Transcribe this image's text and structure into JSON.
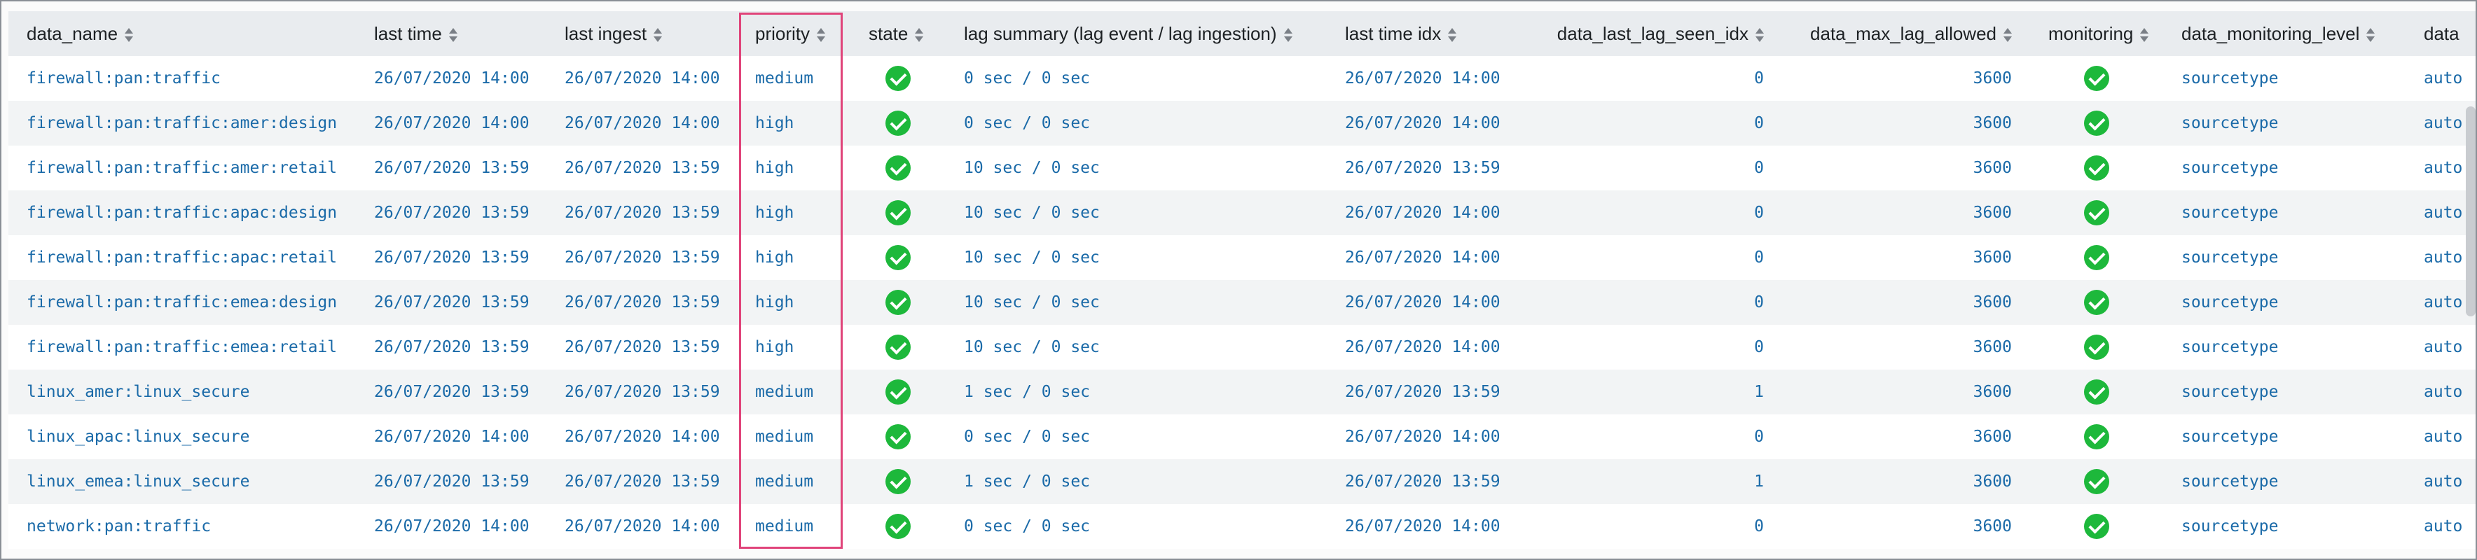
{
  "columns": [
    {
      "label": "data_name"
    },
    {
      "label": "last time"
    },
    {
      "label": "last ingest"
    },
    {
      "label": "priority"
    },
    {
      "label": "state"
    },
    {
      "label": "lag summary (lag event / lag ingestion)"
    },
    {
      "label": "last time idx"
    },
    {
      "label": "data_last_lag_seen_idx"
    },
    {
      "label": "data_max_lag_allowed"
    },
    {
      "label": "monitoring"
    },
    {
      "label": "data_monitoring_level"
    },
    {
      "label": "data"
    }
  ],
  "state_icon": "check-circle-icon",
  "monitoring_icon": "check-circle-icon",
  "status_color": "#1db83b",
  "highlight_color": "#e0447a",
  "rows": [
    {
      "data_name": "firewall:pan:traffic",
      "last_time": "26/07/2020 14:00",
      "last_ingest": "26/07/2020 14:00",
      "priority": "medium",
      "lag_summary": "0 sec / 0 sec",
      "last_time_idx": "26/07/2020 14:00",
      "last_lag_seen_idx": "0",
      "max_lag_allowed": "3600",
      "monitoring_level": "sourcetype",
      "data_extra": "auto"
    },
    {
      "data_name": "firewall:pan:traffic:amer:design",
      "last_time": "26/07/2020 14:00",
      "last_ingest": "26/07/2020 14:00",
      "priority": "high",
      "lag_summary": "0 sec / 0 sec",
      "last_time_idx": "26/07/2020 14:00",
      "last_lag_seen_idx": "0",
      "max_lag_allowed": "3600",
      "monitoring_level": "sourcetype",
      "data_extra": "auto"
    },
    {
      "data_name": "firewall:pan:traffic:amer:retail",
      "last_time": "26/07/2020 13:59",
      "last_ingest": "26/07/2020 13:59",
      "priority": "high",
      "lag_summary": "10 sec / 0 sec",
      "last_time_idx": "26/07/2020 13:59",
      "last_lag_seen_idx": "0",
      "max_lag_allowed": "3600",
      "monitoring_level": "sourcetype",
      "data_extra": "auto"
    },
    {
      "data_name": "firewall:pan:traffic:apac:design",
      "last_time": "26/07/2020 13:59",
      "last_ingest": "26/07/2020 13:59",
      "priority": "high",
      "lag_summary": "10 sec / 0 sec",
      "last_time_idx": "26/07/2020 14:00",
      "last_lag_seen_idx": "0",
      "max_lag_allowed": "3600",
      "monitoring_level": "sourcetype",
      "data_extra": "auto"
    },
    {
      "data_name": "firewall:pan:traffic:apac:retail",
      "last_time": "26/07/2020 13:59",
      "last_ingest": "26/07/2020 13:59",
      "priority": "high",
      "lag_summary": "10 sec / 0 sec",
      "last_time_idx": "26/07/2020 14:00",
      "last_lag_seen_idx": "0",
      "max_lag_allowed": "3600",
      "monitoring_level": "sourcetype",
      "data_extra": "auto"
    },
    {
      "data_name": "firewall:pan:traffic:emea:design",
      "last_time": "26/07/2020 13:59",
      "last_ingest": "26/07/2020 13:59",
      "priority": "high",
      "lag_summary": "10 sec / 0 sec",
      "last_time_idx": "26/07/2020 14:00",
      "last_lag_seen_idx": "0",
      "max_lag_allowed": "3600",
      "monitoring_level": "sourcetype",
      "data_extra": "auto"
    },
    {
      "data_name": "firewall:pan:traffic:emea:retail",
      "last_time": "26/07/2020 13:59",
      "last_ingest": "26/07/2020 13:59",
      "priority": "high",
      "lag_summary": "10 sec / 0 sec",
      "last_time_idx": "26/07/2020 14:00",
      "last_lag_seen_idx": "0",
      "max_lag_allowed": "3600",
      "monitoring_level": "sourcetype",
      "data_extra": "auto"
    },
    {
      "data_name": "linux_amer:linux_secure",
      "last_time": "26/07/2020 13:59",
      "last_ingest": "26/07/2020 13:59",
      "priority": "medium",
      "lag_summary": "1 sec / 0 sec",
      "last_time_idx": "26/07/2020 13:59",
      "last_lag_seen_idx": "1",
      "max_lag_allowed": "3600",
      "monitoring_level": "sourcetype",
      "data_extra": "auto"
    },
    {
      "data_name": "linux_apac:linux_secure",
      "last_time": "26/07/2020 14:00",
      "last_ingest": "26/07/2020 14:00",
      "priority": "medium",
      "lag_summary": "0 sec / 0 sec",
      "last_time_idx": "26/07/2020 14:00",
      "last_lag_seen_idx": "0",
      "max_lag_allowed": "3600",
      "monitoring_level": "sourcetype",
      "data_extra": "auto"
    },
    {
      "data_name": "linux_emea:linux_secure",
      "last_time": "26/07/2020 13:59",
      "last_ingest": "26/07/2020 13:59",
      "priority": "medium",
      "lag_summary": "1 sec / 0 sec",
      "last_time_idx": "26/07/2020 13:59",
      "last_lag_seen_idx": "1",
      "max_lag_allowed": "3600",
      "monitoring_level": "sourcetype",
      "data_extra": "auto"
    },
    {
      "data_name": "network:pan:traffic",
      "last_time": "26/07/2020 14:00",
      "last_ingest": "26/07/2020 14:00",
      "priority": "medium",
      "lag_summary": "0 sec / 0 sec",
      "last_time_idx": "26/07/2020 14:00",
      "last_lag_seen_idx": "0",
      "max_lag_allowed": "3600",
      "monitoring_level": "sourcetype",
      "data_extra": "auto"
    }
  ]
}
